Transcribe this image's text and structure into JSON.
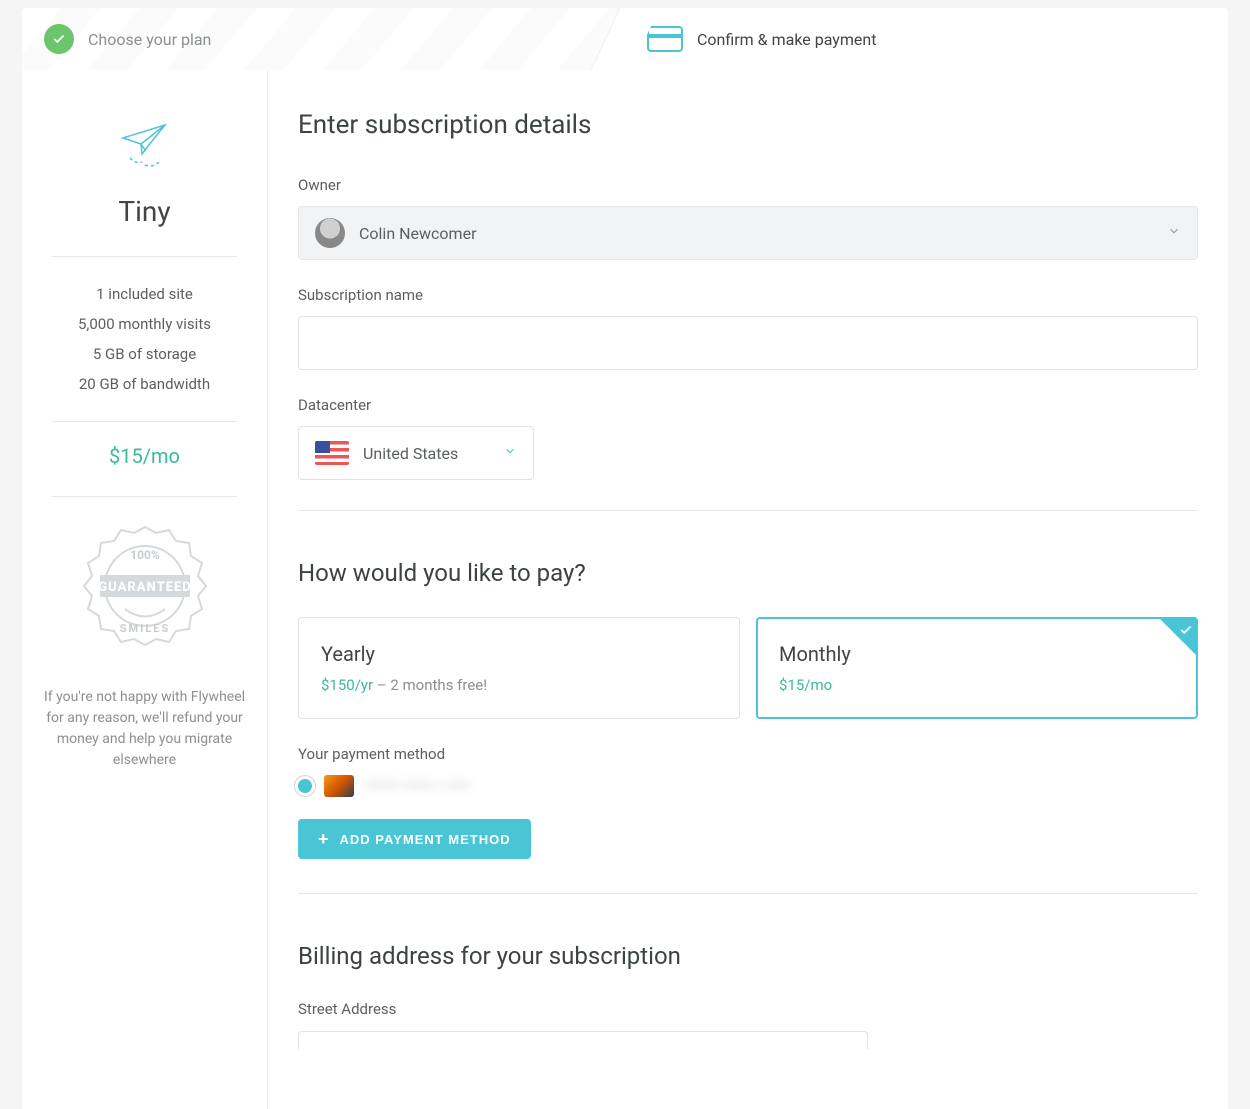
{
  "stepper": {
    "step1": "Choose your plan",
    "step2": "Confirm & make payment"
  },
  "plan": {
    "name": "Tiny",
    "specs": [
      "1 included site",
      "5,000 monthly visits",
      "5 GB of storage",
      "20 GB of bandwidth"
    ],
    "price": "$15/mo"
  },
  "guarantee": {
    "badge_top": "100%",
    "badge_mid": "GUARANTEED",
    "badge_bot": "SMILES",
    "text": "If you're not happy with Flywheel for any reason, we'll refund your money and help you migrate elsewhere"
  },
  "headings": {
    "details": "Enter subscription details",
    "pay": "How would you like to pay?",
    "billing": "Billing address for your subscription"
  },
  "labels": {
    "owner": "Owner",
    "subscription_name": "Subscription name",
    "datacenter": "Datacenter",
    "payment_method": "Your payment method",
    "street": "Street Address"
  },
  "owner": {
    "name": "Colin Newcomer"
  },
  "datacenter": {
    "selected": "United States"
  },
  "billing_options": {
    "yearly": {
      "title": "Yearly",
      "price": "$150/yr",
      "note": " – 2 months free!"
    },
    "monthly": {
      "title": "Monthly",
      "price": "$15/mo"
    },
    "selected": "monthly"
  },
  "payment_method_masked": "•••••• •••••   • ••••",
  "buttons": {
    "add_payment": "ADD PAYMENT METHOD"
  }
}
